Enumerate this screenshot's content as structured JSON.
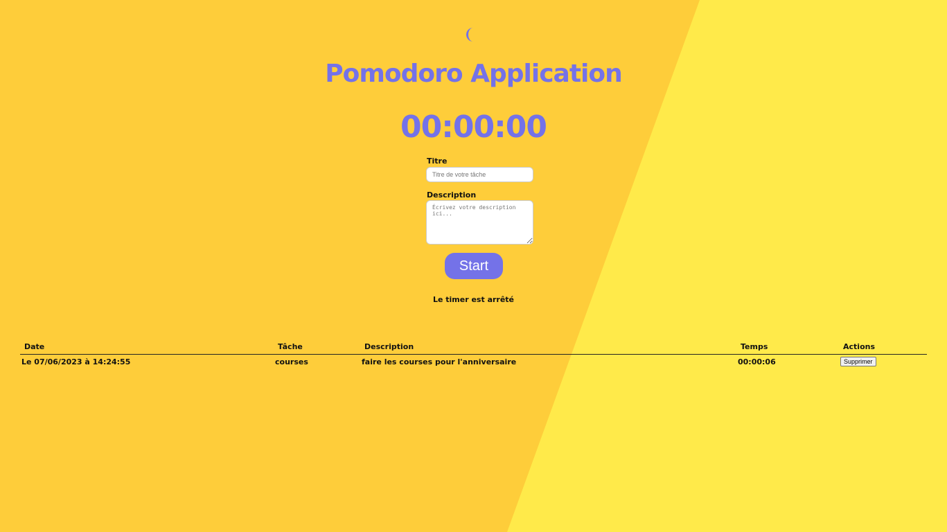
{
  "app": {
    "title": "Pomodoro Application",
    "icon": "moon-icon"
  },
  "timer": {
    "display": "00:00:00"
  },
  "form": {
    "title_label": "Titre",
    "title_placeholder": "Titre de votre tâche",
    "title_value": "",
    "description_label": "Description",
    "description_placeholder": "Écrivez votre description ici...",
    "description_value": "",
    "start_label": "Start"
  },
  "status": {
    "text": "Le timer est arrêté"
  },
  "history": {
    "columns": [
      "Date",
      "Tâche",
      "Description",
      "Temps",
      "Actions"
    ],
    "rows": [
      {
        "date": "Le 07/06/2023 à 14:24:55",
        "task": "courses",
        "description": "faire les courses pour l'anniversaire",
        "time": "00:00:06",
        "action_label": "Supprimer"
      }
    ]
  },
  "colors": {
    "accent": "#7472e8",
    "background_left": "#fecd3a",
    "background_right": "#ffea4a"
  }
}
